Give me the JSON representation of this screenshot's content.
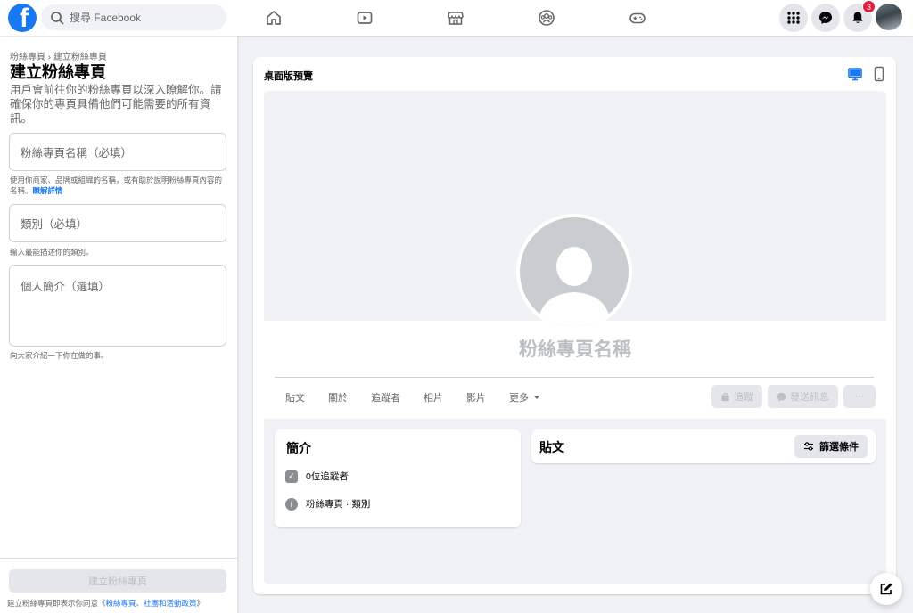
{
  "topbar": {
    "logo_letter": "f",
    "search_placeholder": "搜尋 Facebook",
    "notifications_count": "3",
    "nav_icons": [
      "home-icon",
      "watch-icon",
      "marketplace-icon",
      "groups-icon",
      "gaming-icon"
    ]
  },
  "leftpanel": {
    "breadcrumb": "粉絲專頁 › 建立粉絲專頁",
    "title": "建立粉絲專頁",
    "subtitle": "用戶會前往你的粉絲專頁以深入瞭解你。請確保你的專頁具備他們可能需要的所有資訊。",
    "name_placeholder": "粉絲專頁名稱（必填）",
    "name_helper": "使用你商家、品牌或組織的名稱，或有助於說明粉絲專頁內容的名稱。",
    "name_helper_link": "瞭解詳情",
    "category_placeholder": "類別（必填）",
    "category_helper": "輸入最能描述你的類別。",
    "bio_placeholder": "個人簡介（選填）",
    "bio_helper": "向大家介紹一下你在做的事。",
    "create_button": "建立粉絲專頁",
    "terms_prefix": "建立粉絲專頁即表示你同意《",
    "terms_link": "粉絲專頁、社團和活動政策",
    "terms_suffix": "》"
  },
  "preview": {
    "label": "桌面版預覽",
    "page_name": "粉絲專頁名稱",
    "tabs": [
      "貼文",
      "關於",
      "追蹤者",
      "相片",
      "影片",
      "更多"
    ],
    "follow_button": "追蹤",
    "message_button": "發送訊息",
    "more_button": "···",
    "intro_title": "簡介",
    "followers_text": "0位追蹤者",
    "page_info_text": "粉絲專頁 · 類別",
    "posts_title": "貼文",
    "filter_button": "篩選條件"
  },
  "colors": {
    "brand_blue": "#1877f2",
    "background": "#f0f2f5",
    "badge_red": "#e41e3f",
    "disabled_gray": "#bcc0c4"
  }
}
